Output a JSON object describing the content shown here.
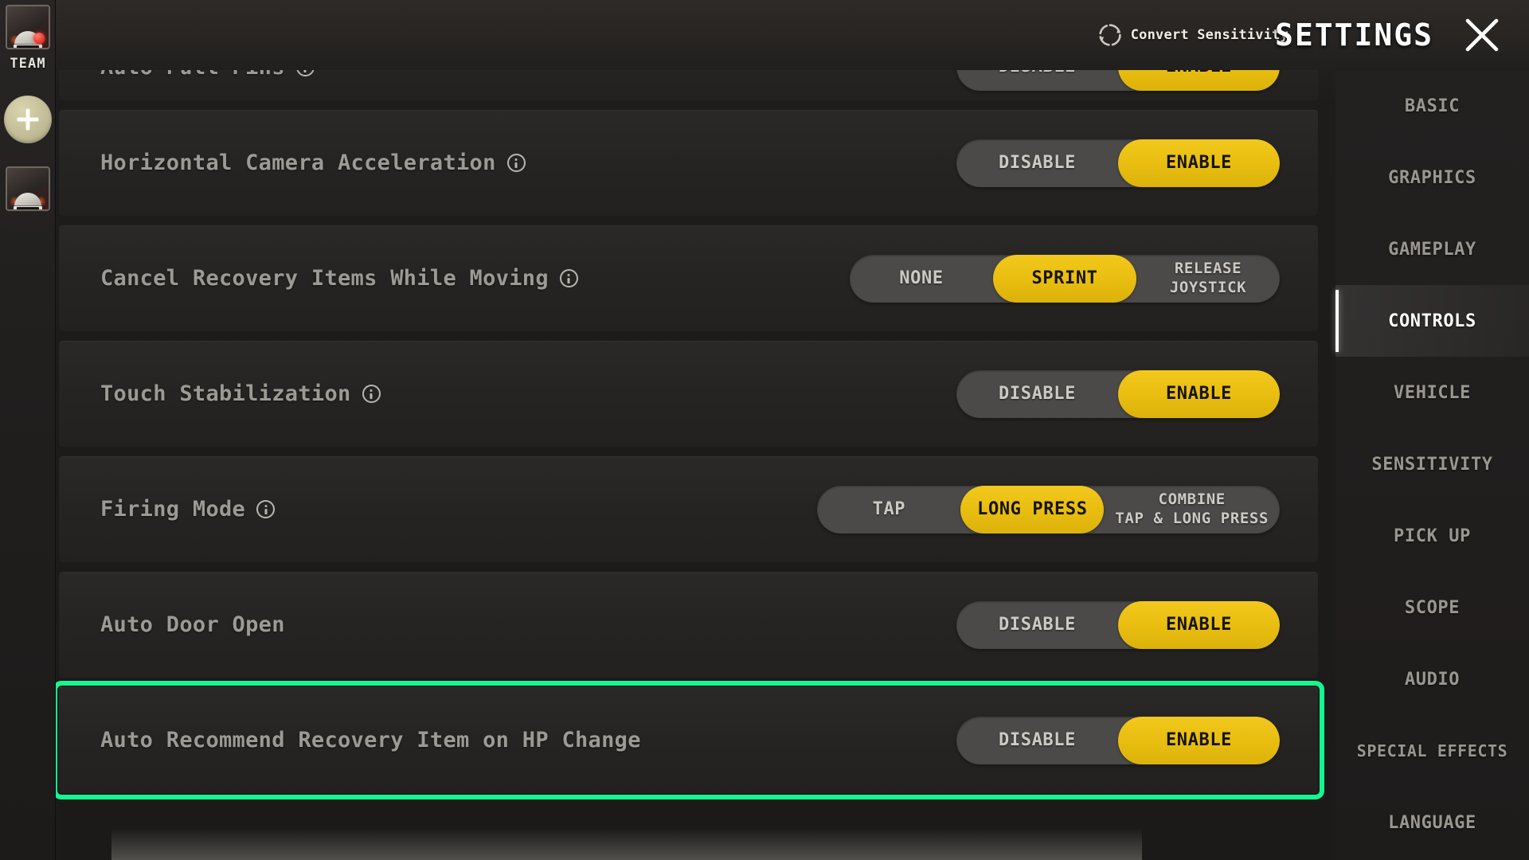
{
  "team_rail": {
    "team_label": "TEAM",
    "add_button_label": "+",
    "avatar_alt": "player-avatar"
  },
  "header": {
    "convert_sensitivity_label": "Convert Sensitivity",
    "title": "SETTINGS",
    "close_label": "✕"
  },
  "tabs": [
    {
      "label": "BASIC",
      "active": false
    },
    {
      "label": "GRAPHICS",
      "active": false
    },
    {
      "label": "GAMEPLAY",
      "active": false
    },
    {
      "label": "CONTROLS",
      "active": true
    },
    {
      "label": "VEHICLE",
      "active": false
    },
    {
      "label": "SENSITIVITY",
      "active": false
    },
    {
      "label": "PICK UP",
      "active": false
    },
    {
      "label": "SCOPE",
      "active": false
    },
    {
      "label": "AUDIO",
      "active": false
    },
    {
      "label": "SPECIAL EFFECTS",
      "active": false
    },
    {
      "label": "LANGUAGE",
      "active": false
    }
  ],
  "settings_rows": [
    {
      "label": "Auto Pull Pins",
      "has_info": true,
      "clipped": true,
      "highlighted": false,
      "options": [
        {
          "label": "DISABLE",
          "selected": false
        },
        {
          "label": "ENABLE",
          "selected": true
        }
      ]
    },
    {
      "label": "Horizontal Camera Acceleration",
      "has_info": true,
      "clipped": false,
      "highlighted": false,
      "options": [
        {
          "label": "DISABLE",
          "selected": false
        },
        {
          "label": "ENABLE",
          "selected": true
        }
      ]
    },
    {
      "label": "Cancel Recovery Items While Moving",
      "has_info": true,
      "clipped": false,
      "highlighted": false,
      "options": [
        {
          "label": "NONE",
          "selected": false
        },
        {
          "label": "SPRINT",
          "selected": true
        },
        {
          "label": "RELEASE\nJOYSTICK",
          "selected": false
        }
      ]
    },
    {
      "label": "Touch Stabilization",
      "has_info": true,
      "clipped": false,
      "highlighted": false,
      "options": [
        {
          "label": "DISABLE",
          "selected": false
        },
        {
          "label": "ENABLE",
          "selected": true
        }
      ]
    },
    {
      "label": "Firing Mode",
      "has_info": true,
      "clipped": false,
      "highlighted": false,
      "options": [
        {
          "label": "TAP",
          "selected": false
        },
        {
          "label": "LONG PRESS",
          "selected": true
        },
        {
          "label": "COMBINE\nTAP & LONG PRESS",
          "selected": false
        }
      ]
    },
    {
      "label": "Auto Door Open",
      "has_info": false,
      "clipped": false,
      "highlighted": false,
      "options": [
        {
          "label": "DISABLE",
          "selected": false
        },
        {
          "label": "ENABLE",
          "selected": true
        }
      ]
    },
    {
      "label": "Auto Recommend Recovery Item on HP Change",
      "has_info": false,
      "clipped": false,
      "highlighted": true,
      "options": [
        {
          "label": "DISABLE",
          "selected": false
        },
        {
          "label": "ENABLE",
          "selected": true
        }
      ]
    }
  ],
  "colors": {
    "accent_yellow": "#EFC314",
    "highlight_green": "#13F891",
    "panel_bg": "#262423",
    "track_gray": "#4B4A48",
    "text_muted": "#9D9A95",
    "text_bright": "#FFFFFF",
    "add_button": "#C3BD98"
  }
}
